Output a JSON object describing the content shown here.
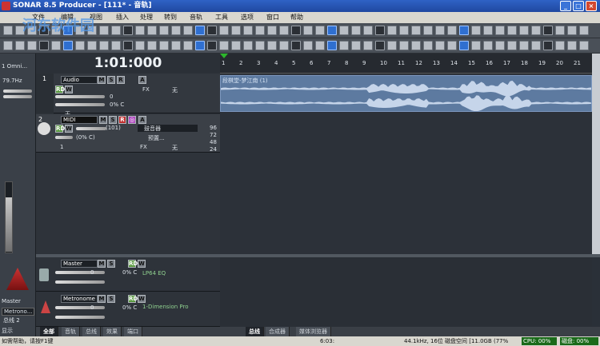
{
  "app": {
    "title": "SONAR 8.5 Producer - [111* - 音轨]"
  },
  "window_buttons": [
    "_",
    "□",
    "×"
  ],
  "menu": [
    "文件",
    "编辑",
    "视图",
    "插入",
    "处理",
    "转到",
    "音轨",
    "工具",
    "选项",
    "窗口",
    "帮助"
  ],
  "toolbar": {
    "preset": "",
    "zoom": ""
  },
  "transport": {
    "time": "1:01:000",
    "sample_rate": "79.7Hz"
  },
  "ruler": [
    "1",
    "2",
    "3",
    "4",
    "5",
    "6",
    "7",
    "8",
    "9",
    "10",
    "11",
    "12",
    "13",
    "14",
    "15",
    "16",
    "17",
    "18",
    "19",
    "20",
    "21"
  ],
  "left": {
    "input": "1 Omni...",
    "master": "Master",
    "metronome": "Metrono...",
    "bus": "总线 2",
    "display": "显示"
  },
  "tracks": [
    {
      "num": "1",
      "name": "Audio",
      "vol": "0",
      "pan": "0% C",
      "fx_label": "FX",
      "fx_value": "无",
      "input": "无",
      "clip_name": "段棋堂-梦江南 (1)"
    },
    {
      "num": "2",
      "name": "MIDI",
      "vol": "(101)",
      "pan": "(0% C)",
      "instrument": "鼓音器",
      "bank": "预置...",
      "channel": "1",
      "fx_label": "FX",
      "fx_value": "无",
      "notes": [
        "96",
        "72",
        "48",
        "24"
      ]
    }
  ],
  "buses": [
    {
      "name": "Master",
      "vol": "0",
      "pan": "0% C",
      "plugin": "LP64 EQ"
    },
    {
      "name": "Metronome",
      "vol": "0",
      "pan": "0% C",
      "plugin": "1-Dimension Pro"
    }
  ],
  "tabs_left": [
    "全部",
    "音轨",
    "总线",
    "效果",
    "端口"
  ],
  "tabs_right": [
    "总线",
    "合成器",
    "媒体浏览器"
  ],
  "status": {
    "help": "如需帮助，请按F1键",
    "time": "6:03:",
    "info": "44.1kHz, 16位",
    "disk": "磁盘空间 [11.0GB (77%",
    "cpu": "CPU: 00%",
    "disk_usage": "磁盘: 00%"
  },
  "watermark": "河东软件园"
}
